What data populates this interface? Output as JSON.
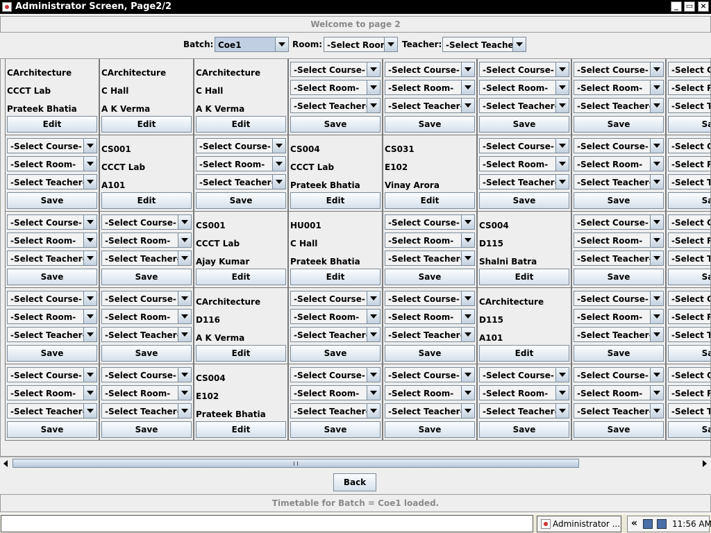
{
  "window": {
    "title": "Administrator Screen, Page2/2",
    "minimize_label": "_",
    "maximize_label": "▭",
    "close_label": "×"
  },
  "welcome_text": "Welcome to page 2",
  "filters": {
    "batch_label": "Batch:",
    "batch_value": "Coe1",
    "room_label": "Room:",
    "room_value": "-Select Room-",
    "teacher_label": "Teacher:",
    "teacher_value": "-Select Teacher-"
  },
  "labels": {
    "save": "Save",
    "edit": "Edit",
    "select_course": "-Select Course-",
    "select_room": "-Select Room-",
    "select_teacher": "-Select Teacher-"
  },
  "grid": [
    [
      {
        "mode": "view",
        "course": "CArchitecture",
        "room": "CCCT Lab",
        "teacher": "Prateek Bhatia"
      },
      {
        "mode": "view",
        "course": "CArchitecture",
        "room": "C Hall",
        "teacher": "A K Verma"
      },
      {
        "mode": "view",
        "course": "CArchitecture",
        "room": "C Hall",
        "teacher": "A K Verma"
      },
      {
        "mode": "edit"
      },
      {
        "mode": "edit"
      },
      {
        "mode": "edit"
      },
      {
        "mode": "edit"
      },
      {
        "mode": "edit"
      }
    ],
    [
      {
        "mode": "edit"
      },
      {
        "mode": "view",
        "course": "CS001",
        "room": "CCCT Lab",
        "teacher": "A101"
      },
      {
        "mode": "edit"
      },
      {
        "mode": "view",
        "course": "CS004",
        "room": "CCCT Lab",
        "teacher": "Prateek Bhatia"
      },
      {
        "mode": "view",
        "course": "CS031",
        "room": "E102",
        "teacher": "Vinay Arora"
      },
      {
        "mode": "edit"
      },
      {
        "mode": "edit"
      },
      {
        "mode": "edit"
      }
    ],
    [
      {
        "mode": "edit"
      },
      {
        "mode": "edit"
      },
      {
        "mode": "view",
        "course": "CS001",
        "room": "CCCT Lab",
        "teacher": "Ajay Kumar"
      },
      {
        "mode": "view",
        "course": "HU001",
        "room": "C Hall",
        "teacher": "Prateek Bhatia"
      },
      {
        "mode": "edit"
      },
      {
        "mode": "view",
        "course": "CS004",
        "room": "D115",
        "teacher": "Shalni Batra"
      },
      {
        "mode": "edit"
      },
      {
        "mode": "edit"
      }
    ],
    [
      {
        "mode": "edit"
      },
      {
        "mode": "edit"
      },
      {
        "mode": "view",
        "course": "CArchitecture",
        "room": "D116",
        "teacher": "A K Verma"
      },
      {
        "mode": "edit"
      },
      {
        "mode": "edit"
      },
      {
        "mode": "view",
        "course": "CArchitecture",
        "room": "D115",
        "teacher": "A101"
      },
      {
        "mode": "edit"
      },
      {
        "mode": "edit"
      }
    ],
    [
      {
        "mode": "edit"
      },
      {
        "mode": "edit"
      },
      {
        "mode": "view",
        "course": "CS004",
        "room": "E102",
        "teacher": "Prateek Bhatia"
      },
      {
        "mode": "edit"
      },
      {
        "mode": "edit"
      },
      {
        "mode": "edit"
      },
      {
        "mode": "edit"
      },
      {
        "mode": "edit"
      }
    ]
  ],
  "back_label": "Back",
  "status_text": "Timetable for Batch = Coe1 loaded.",
  "taskbar": {
    "app_label": "Administrator ...",
    "tray_chevron": "«",
    "clock": "11:56 AM"
  }
}
